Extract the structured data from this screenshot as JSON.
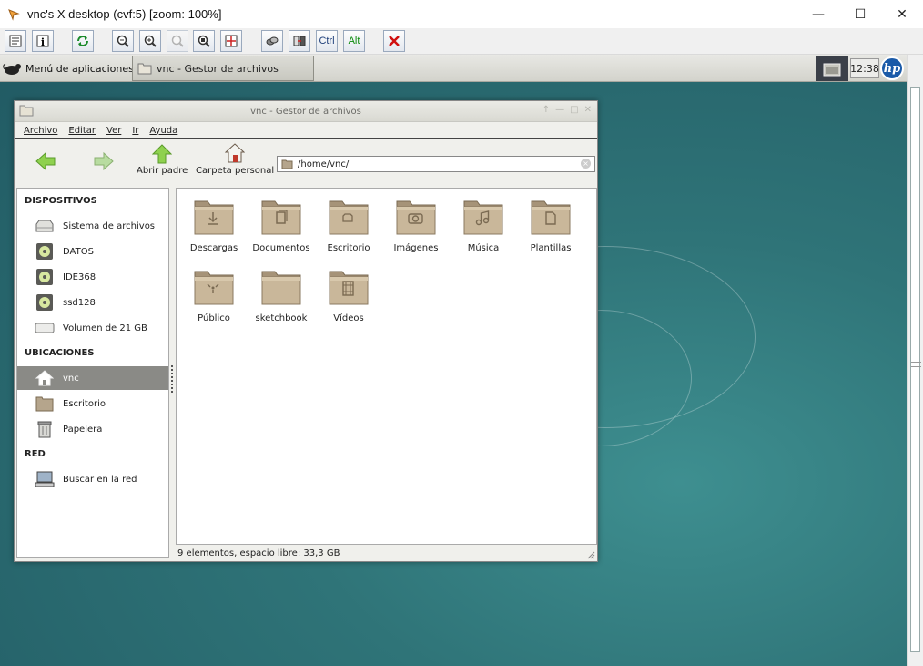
{
  "vnc": {
    "title": "vnc's X desktop (cvf:5) [zoom: 100%]",
    "toolbar": {
      "ctrl_label": "Ctrl",
      "alt_label": "Alt"
    }
  },
  "panel": {
    "app_menu_label": "Menú de aplicaciones",
    "task_label": "vnc - Gestor de archivos",
    "clock": "12:38",
    "logo": "hp"
  },
  "filemanager": {
    "title": "vnc - Gestor de archivos",
    "menu": [
      "Archivo",
      "Editar",
      "Ver",
      "Ir",
      "Ayuda"
    ],
    "toolbar": {
      "parent_label": "Abrir padre",
      "home_label": "Carpeta personal"
    },
    "location": "/home/vnc/",
    "sidebar": {
      "devices_header": "DISPOSITIVOS",
      "devices": [
        "Sistema de archivos",
        "DATOS",
        "IDE368",
        "ssd128",
        "Volumen de 21 GB"
      ],
      "places_header": "UBICACIONES",
      "places": [
        "vnc",
        "Escritorio",
        "Papelera"
      ],
      "network_header": "RED",
      "network": [
        "Buscar en la red"
      ]
    },
    "folders": [
      "Descargas",
      "Documentos",
      "Escritorio",
      "Imágenes",
      "Música",
      "Plantillas",
      "Público",
      "sketchbook",
      "Vídeos"
    ],
    "status": "9 elementos, espacio libre: 33,3 GB"
  }
}
